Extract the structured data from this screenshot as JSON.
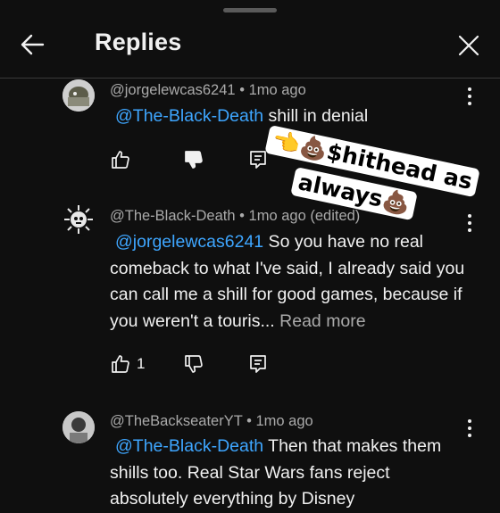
{
  "header": {
    "title": "Replies"
  },
  "comments": [
    {
      "author": "@jorgelewcas6241",
      "time": "1mo ago",
      "edited": "",
      "mention": "@The-Black-Death",
      "text": " shill in denial",
      "read_more": "",
      "likes": ""
    },
    {
      "author": "@The-Black-Death",
      "time": "1mo ago",
      "edited": "(edited)",
      "mention": "@jorgelewcas6241",
      "text": "  So you have no real comeback to what I've said, I already said you can call me a shill for good games, because if you weren't a touris... ",
      "read_more": "Read more",
      "likes": "1"
    },
    {
      "author": "@TheBackseaterYT",
      "time": "1mo ago",
      "edited": "",
      "mention": "@The-Black-Death",
      "text": " Then that makes them shills too. Real Star Wars fans reject absolutely everything by Disney",
      "read_more": "",
      "likes": ""
    }
  ],
  "sticker": {
    "line1": "👈💩$hithead as",
    "line2": "always💩"
  },
  "colors": {
    "background": "#0f0f0f",
    "mention": "#3ea6ff",
    "meta": "#aaaaaa"
  }
}
